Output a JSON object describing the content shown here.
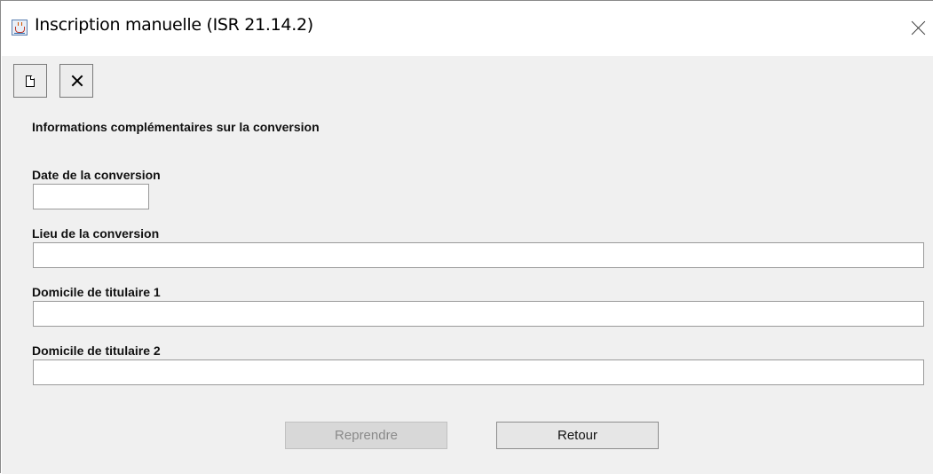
{
  "window": {
    "title": "Inscription manuelle (ISR 21.14.2)",
    "app_icon": "java-cup-icon",
    "close_icon": "close-icon"
  },
  "toolbar": {
    "new_icon": "new-document-icon",
    "delete_icon": "delete-x-icon"
  },
  "form": {
    "section_title": "Informations complémentaires sur la conversion",
    "date_label": "Date de la conversion",
    "date_value": "",
    "lieu_label": "Lieu de la conversion",
    "lieu_value": "",
    "domicile1_label": "Domicile de titulaire 1",
    "domicile1_value": "",
    "domicile2_label": "Domicile de titulaire 2",
    "domicile2_value": ""
  },
  "buttons": {
    "reprendre_label": "Reprendre",
    "reprendre_enabled": false,
    "retour_label": "Retour"
  },
  "colors": {
    "panel_background": "#f0f0f0",
    "titlebar_background": "#ffffff"
  }
}
